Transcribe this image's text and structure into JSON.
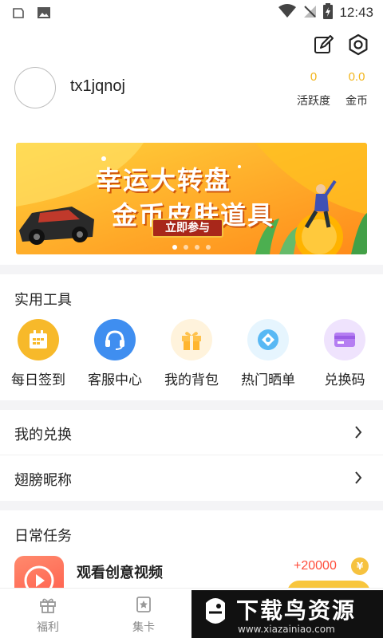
{
  "status_bar": {
    "time": "12:43"
  },
  "profile": {
    "username": "tx1jqnoj",
    "stats": [
      {
        "value": "0",
        "label": "活跃度"
      },
      {
        "value": "0.0",
        "label": "金币"
      }
    ]
  },
  "banner": {
    "line1": "幸运大转盘",
    "line2": "金币皮肤道具",
    "cta": "立即参与",
    "active_index": 0
  },
  "tools": {
    "title": "实用工具",
    "items": [
      {
        "label": "每日签到",
        "icon": "calendar-icon",
        "color": "#f7b92a"
      },
      {
        "label": "客服中心",
        "icon": "headset-icon",
        "color": "#3f8ef0"
      },
      {
        "label": "我的背包",
        "icon": "gift-icon",
        "color": "#ffc24d"
      },
      {
        "label": "热门晒单",
        "icon": "diamond-icon",
        "color": "#58b8f4"
      },
      {
        "label": "兑换码",
        "icon": "card-icon",
        "color": "#b57ef2"
      }
    ]
  },
  "list": [
    {
      "label": "我的兑换"
    },
    {
      "label": "翅膀昵称"
    }
  ],
  "daily": {
    "title": "日常任务",
    "task": {
      "title": "观看创意视频",
      "reward": "+20000",
      "coin_symbol": "¥"
    }
  },
  "nav": [
    {
      "label": "福利",
      "icon": "gift-icon"
    },
    {
      "label": "集卡",
      "icon": "star-card-icon"
    }
  ],
  "watermark": {
    "title": "下载鸟资源",
    "url": "www.xiazainiao.com"
  }
}
